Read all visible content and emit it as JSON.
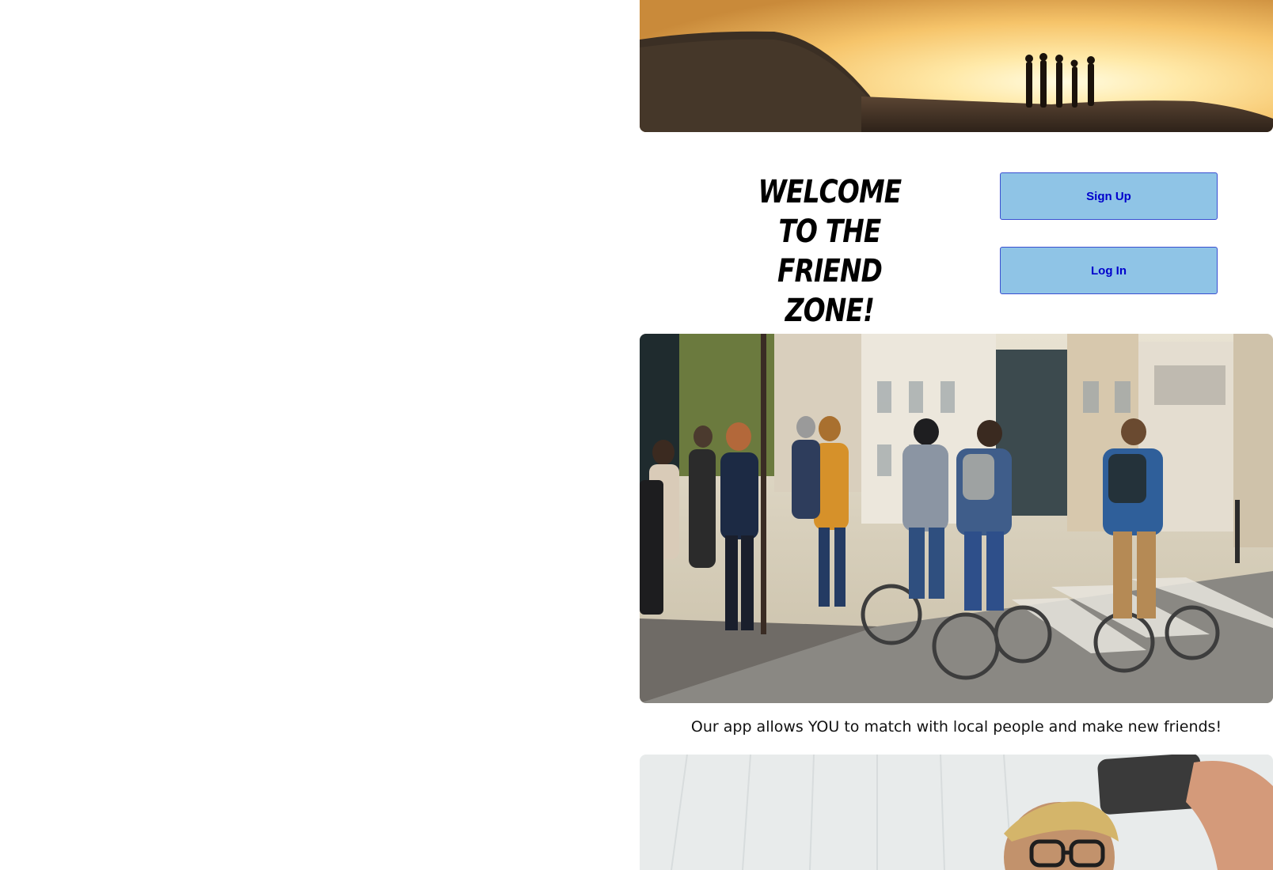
{
  "hero": {
    "image_name": "friends-silhouette-sunset-photo"
  },
  "welcome": {
    "line1": "Welcome",
    "line2": "to the",
    "line3": "Friend Zone!"
  },
  "auth": {
    "signup_label": "Sign Up",
    "login_label": "Log In"
  },
  "street": {
    "image_name": "people-walking-and-cycling-street-photo"
  },
  "tagline": "Our app allows YOU to match with local people and make new friends!",
  "selfie": {
    "image_name": "man-taking-selfie-photo"
  },
  "colors": {
    "button_bg": "#8fc4e6",
    "button_border": "#3a4fd1",
    "button_text": "#0000cc"
  }
}
